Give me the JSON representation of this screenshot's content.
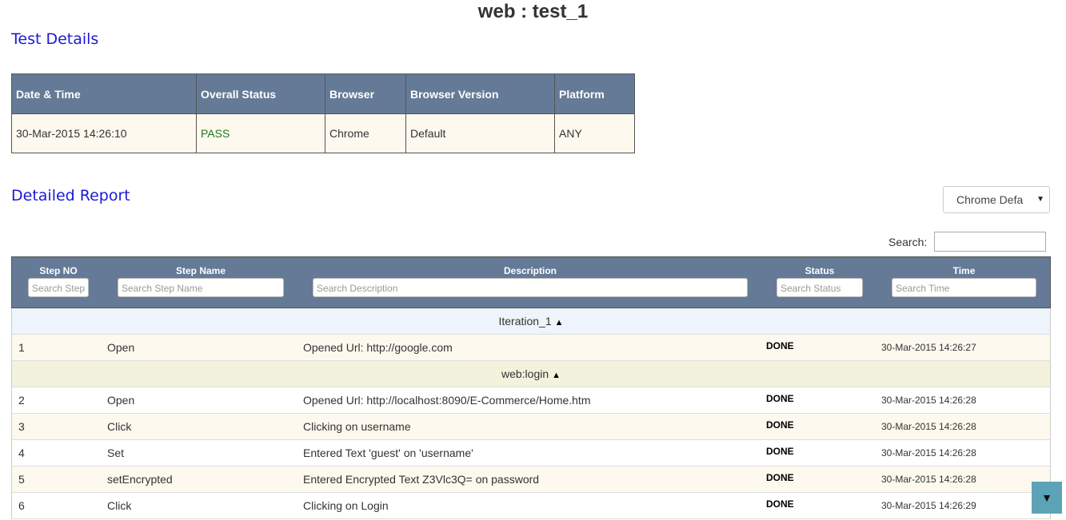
{
  "page": {
    "title": "web : test_1"
  },
  "sections": {
    "test_details": "Test Details",
    "detailed_report": "Detailed Report"
  },
  "summary": {
    "headers": [
      "Date & Time",
      "Overall Status",
      "Browser",
      "Browser Version",
      "Platform"
    ],
    "values": [
      "30-Mar-2015 14:26:10",
      "PASS",
      "Chrome",
      "Default",
      "ANY"
    ]
  },
  "env_select": {
    "value": "Chrome Defa",
    "caret": "▼"
  },
  "search": {
    "label": "Search:"
  },
  "report": {
    "columns": [
      {
        "label": "Step NO",
        "placeholder": "Search Step"
      },
      {
        "label": "Step Name",
        "placeholder": "Search Step Name"
      },
      {
        "label": "Description",
        "placeholder": "Search Description"
      },
      {
        "label": "Status",
        "placeholder": "Search Status"
      },
      {
        "label": "Time",
        "placeholder": "Search Time"
      }
    ],
    "iteration": {
      "label": "Iteration_1",
      "toggle": "▲"
    },
    "component": {
      "label": "web:login",
      "toggle": "▲"
    },
    "rows": [
      {
        "no": "1",
        "name": "Open",
        "desc": "Opened Url: http://google.com",
        "status": "DONE",
        "time": "30-Mar-2015 14:26:27"
      },
      {
        "no": "2",
        "name": "Open",
        "desc": "Opened Url: http://localhost:8090/E-Commerce/Home.htm",
        "status": "DONE",
        "time": "30-Mar-2015 14:26:28"
      },
      {
        "no": "3",
        "name": "Click",
        "desc": "Clicking on username",
        "status": "DONE",
        "time": "30-Mar-2015 14:26:28"
      },
      {
        "no": "4",
        "name": "Set",
        "desc": "Entered Text 'guest' on 'username'",
        "status": "DONE",
        "time": "30-Mar-2015 14:26:28"
      },
      {
        "no": "5",
        "name": "setEncrypted",
        "desc": "Entered Encrypted Text Z3Vlc3Q= on password",
        "status": "DONE",
        "time": "30-Mar-2015 14:26:28"
      },
      {
        "no": "6",
        "name": "Click",
        "desc": "Clicking on Login",
        "status": "DONE",
        "time": "30-Mar-2015 14:26:29"
      }
    ]
  },
  "scroll_button": {
    "icon": "caret-down-icon",
    "glyph": "▼"
  },
  "colors": {
    "header_bg": "#657a96",
    "pass": "#1f7a1f",
    "link_title": "#1a1ad6",
    "scroll_btn": "#5da3b8"
  }
}
